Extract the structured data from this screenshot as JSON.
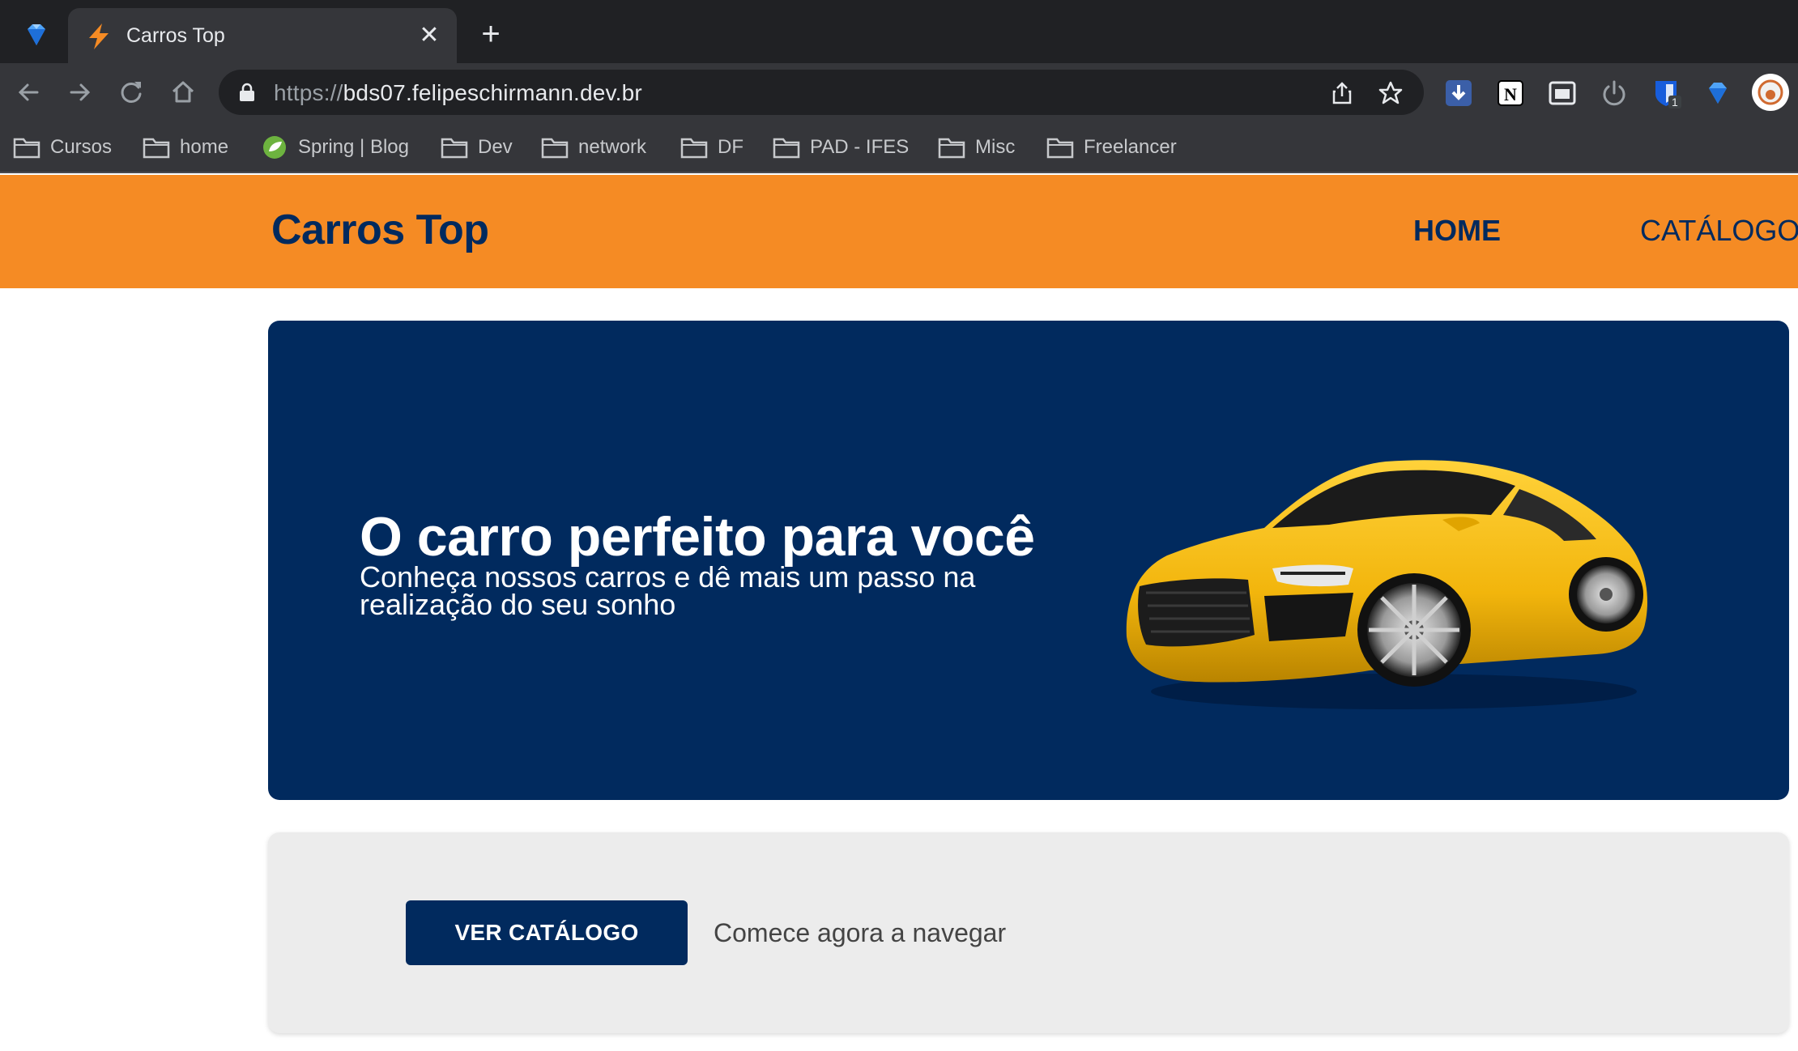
{
  "browser": {
    "tab_title": "Carros Top",
    "url_scheme": "https://",
    "url_host": "bds07.felipeschirmann.dev.br",
    "extension_badge": "1",
    "bookmarks": [
      "Cursos",
      "home",
      "Spring | Blog",
      "Dev",
      "network",
      "DF",
      "PAD - IFES",
      "Misc",
      "Freelancer"
    ]
  },
  "site": {
    "brand": "Carros Top",
    "nav": {
      "home": "HOME",
      "catalog": "CATÁLOGO"
    },
    "hero": {
      "title": "O carro perfeito para você",
      "subtitle": "Conheça nossos carros e dê mais um passo na realização do seu sonho",
      "image": "yellow-sports-car"
    },
    "cta": {
      "button": "VER CATÁLOGO",
      "text": "Comece agora a navegar"
    }
  },
  "colors": {
    "nav_background": "#f58b24",
    "primary": "#012a5e",
    "card_background": "#ececec"
  }
}
